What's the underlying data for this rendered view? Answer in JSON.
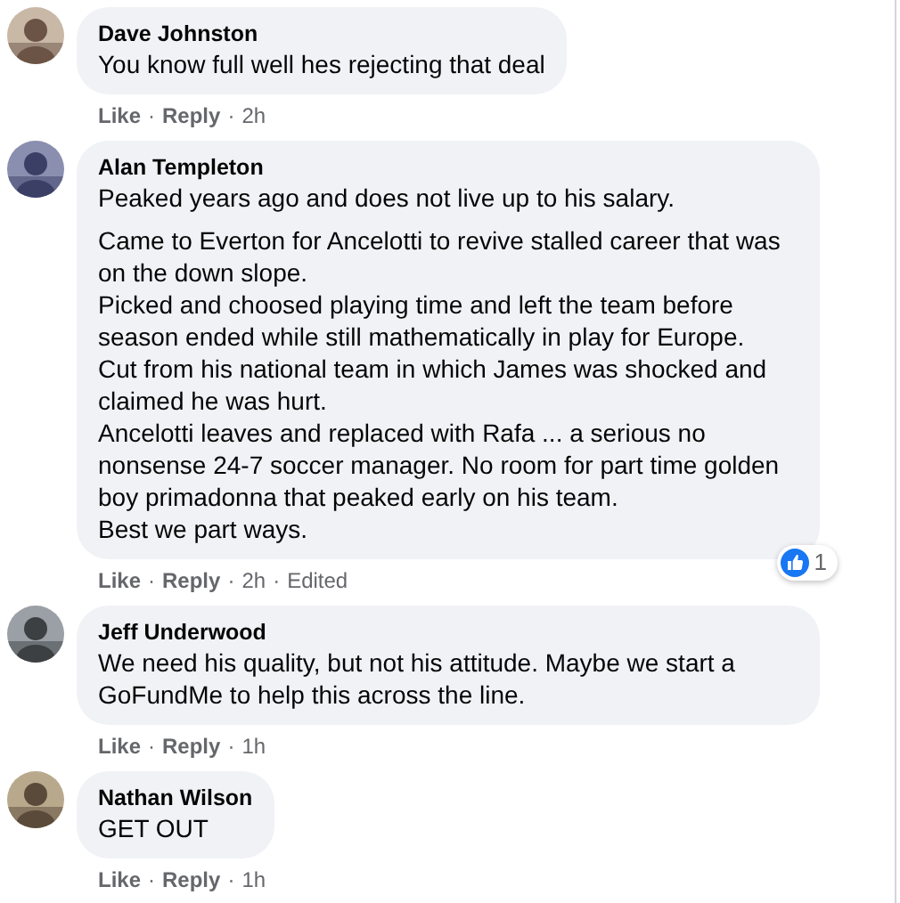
{
  "comments": [
    {
      "author": "Dave Johnston",
      "avatar": {
        "kind": "picture"
      },
      "paragraphs": [
        "You know full well hes rejecting that deal"
      ],
      "actions": [
        {
          "kind": "link",
          "text": "Like"
        },
        {
          "kind": "sep",
          "text": "·"
        },
        {
          "kind": "link",
          "text": "Reply"
        },
        {
          "kind": "sep",
          "text": "·"
        },
        {
          "kind": "text",
          "text": "2h"
        }
      ]
    },
    {
      "author": "Alan Templeton",
      "avatar": {
        "kind": "picture"
      },
      "paragraphs": [
        "Peaked years ago and does not live up to his salary.",
        "Came to Everton for Ancelotti to revive stalled career that was on the down slope.\nPicked and choosed playing time and left the team before season ended while still mathematically in play for Europe.\nCut from his national team in which James was shocked and claimed he was hurt.\nAncelotti leaves and replaced with Rafa ... a serious no nonsense 24-7 soccer manager. No room for part time golden boy primadonna that peaked early on his team.\nBest we part ways."
      ],
      "reactions": {
        "count": "1"
      },
      "actions": [
        {
          "kind": "link",
          "text": "Like"
        },
        {
          "kind": "sep",
          "text": "·"
        },
        {
          "kind": "link",
          "text": "Reply"
        },
        {
          "kind": "sep",
          "text": "·"
        },
        {
          "kind": "text",
          "text": "2h"
        },
        {
          "kind": "sep",
          "text": "·"
        },
        {
          "kind": "text",
          "text": "Edited"
        }
      ]
    },
    {
      "author": "Jeff Underwood",
      "avatar": {
        "kind": "picture"
      },
      "paragraphs": [
        "We need his quality, but not his attitude. Maybe we start a GoFundMe to help this across the line."
      ],
      "actions": [
        {
          "kind": "link",
          "text": "Like"
        },
        {
          "kind": "sep",
          "text": "·"
        },
        {
          "kind": "link",
          "text": "Reply"
        },
        {
          "kind": "sep",
          "text": "·"
        },
        {
          "kind": "text",
          "text": "1h"
        }
      ]
    },
    {
      "author": "Nathan Wilson",
      "avatar": {
        "kind": "picture"
      },
      "paragraphs": [
        "GET OUT"
      ],
      "actions": [
        {
          "kind": "link",
          "text": "Like"
        },
        {
          "kind": "sep",
          "text": "·"
        },
        {
          "kind": "link",
          "text": "Reply"
        },
        {
          "kind": "sep",
          "text": "·"
        },
        {
          "kind": "text",
          "text": "1h"
        }
      ]
    }
  ]
}
